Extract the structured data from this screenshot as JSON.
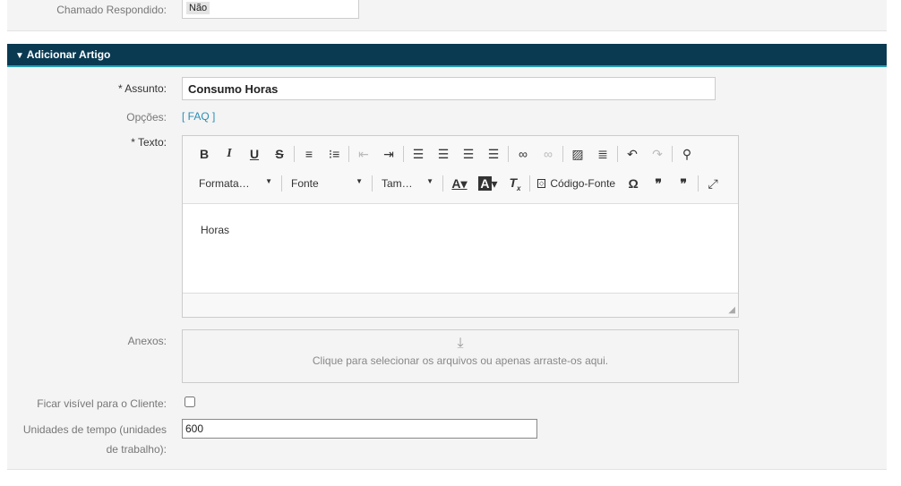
{
  "top": {
    "label": "Chamado Respondido:",
    "value": "Não"
  },
  "section": {
    "title": "Adicionar Artigo"
  },
  "subject": {
    "label": "Assunto:",
    "value": "Consumo Horas"
  },
  "options": {
    "label": "Opções:",
    "link": "[ FAQ ]"
  },
  "text": {
    "label": "Texto:",
    "content": "Horas"
  },
  "toolbar": {
    "format": "Formata…",
    "font": "Fonte",
    "size": "Tam…",
    "source": "Código-Fonte"
  },
  "attachments": {
    "label": "Anexos:",
    "hint": "Clique para selecionar os arquivos ou apenas arraste-os aqui."
  },
  "visible": {
    "label": "Ficar visível para o Cliente:",
    "checked": false
  },
  "units": {
    "label1": "Unidades de tempo (unidades",
    "label2": "de trabalho):",
    "value": "600"
  }
}
